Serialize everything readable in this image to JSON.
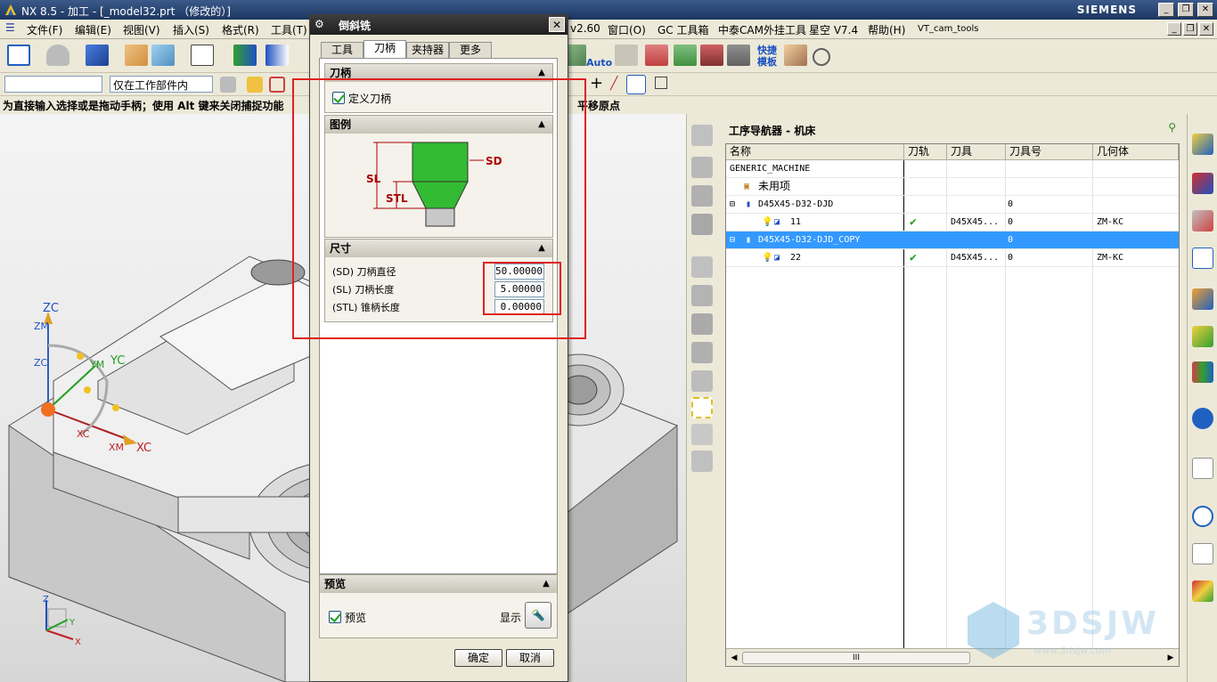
{
  "window": {
    "title": "NX 8.5 - 加工 - [_model32.prt （修改的）]",
    "brand": "SIEMENS"
  },
  "menubar": {
    "items": [
      "文件(F)",
      "编辑(E)",
      "视图(V)",
      "插入(S)",
      "格式(R)",
      "工具(T)"
    ],
    "right_items": [
      "v2.60",
      "窗口(O)",
      "GC 工具箱",
      "中泰CAM外挂工具",
      "星空 V7.4",
      "帮助(H)",
      "VT_cam_tools"
    ]
  },
  "toolbar": {
    "auto_label": "Auto",
    "template_label": "快捷模板",
    "filter_value": "仅在工作部件内",
    "filter_left_value": ""
  },
  "cue_line": {
    "text": "为直接输入选择或是拖动手柄；使用 Alt 键来关闭捕捉功能",
    "right_text": "平移原点"
  },
  "viewport": {
    "triad_labels": {
      "zc": "ZC",
      "zm": "ZM",
      "zc2": "ZC",
      "ym": "YM",
      "yc": "YC",
      "xc": "XC",
      "xm": "XM",
      "xc2": "XC"
    },
    "mini_axes": {
      "z": "Z",
      "y": "Y",
      "x": "X"
    }
  },
  "dialog": {
    "title": "倒斜铣",
    "tabs": [
      "工具",
      "刀柄",
      "夹持器",
      "更多"
    ],
    "active_tab": "刀柄",
    "holder_group": {
      "header": "刀柄",
      "define_holder_label": "定义刀柄",
      "define_holder_checked": true
    },
    "legend_group": {
      "header": "图例",
      "labels": {
        "sd": "SD",
        "sl": "SL",
        "stl": "STL"
      }
    },
    "dims_group": {
      "header": "尺寸",
      "fields": [
        {
          "label": "(SD) 刀柄直径",
          "value": "50.00000"
        },
        {
          "label": "(SL) 刀柄长度",
          "value": "5.00000"
        },
        {
          "label": "(STL) 锥柄长度",
          "value": "0.00000"
        }
      ]
    },
    "preview_group": {
      "header": "预览",
      "preview_label": "预览",
      "preview_checked": true,
      "show_label": "显示"
    },
    "ok_label": "确定",
    "cancel_label": "取消"
  },
  "navigator": {
    "title": "工序导航器 - 机床",
    "columns": [
      "名称",
      "刀轨",
      "刀具",
      "刀具号",
      "几何体"
    ],
    "rows": [
      {
        "name": "GENERIC_MACHINE",
        "path": "",
        "tool": "",
        "tool_no": "",
        "geom": "",
        "selected": false
      },
      {
        "name": "未用项",
        "path": "",
        "tool": "",
        "tool_no": "",
        "geom": "",
        "selected": false
      },
      {
        "name": "D45X45-D32-DJD",
        "path": "",
        "tool": "",
        "tool_no": "0",
        "geom": "",
        "selected": false
      },
      {
        "name": "11",
        "path": "✔",
        "tool": "D45X45...",
        "tool_no": "0",
        "geom": "ZM-KC",
        "selected": false
      },
      {
        "name": "D45X45-D32-DJD_COPY",
        "path": "",
        "tool": "",
        "tool_no": "0",
        "geom": "",
        "selected": true
      },
      {
        "name": "22",
        "path": "✔",
        "tool": "D45X45...",
        "tool_no": "0",
        "geom": "ZM-KC",
        "selected": false
      }
    ],
    "scroll_label": "III"
  },
  "watermark": {
    "text": "3DSJW",
    "sub": "www.3dsjw.com"
  },
  "colors": {
    "accent": "#3399ff",
    "highlight": "#e02020",
    "tool_green": "#33bb33",
    "check_green": "#21a121"
  },
  "icons": [
    "nx-logo-icon",
    "fit-icon",
    "tool-icon",
    "cube-icon",
    "gear-icon",
    "close-icon",
    "chevron-up-icon",
    "flashlight-icon",
    "machine-tool-icon",
    "program-icon",
    "tool-holder-icon",
    "check-icon",
    "bulb-icon",
    "info-icon",
    "clock-icon",
    "palette-icon"
  ]
}
